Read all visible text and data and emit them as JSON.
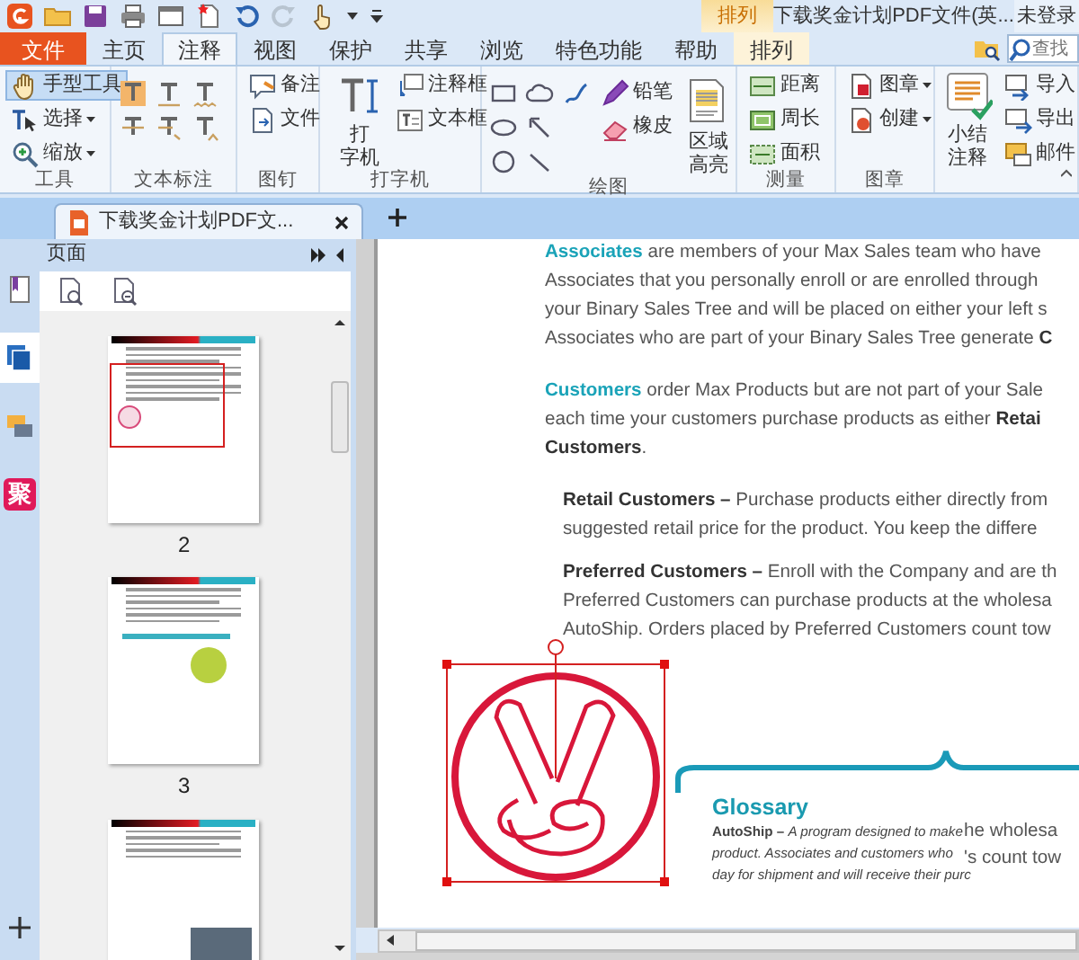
{
  "quick_access": {
    "redo_disabled": true
  },
  "window": {
    "context_tab": "排列",
    "title": "下载奖金计划PDF文件(英...",
    "account": "未登录"
  },
  "tabs": [
    {
      "label": "文件",
      "kind": "file",
      "selected": false
    },
    {
      "label": "主页",
      "kind": "tab",
      "selected": false
    },
    {
      "label": "注释",
      "kind": "tab",
      "selected": true
    },
    {
      "label": "视图",
      "kind": "tab",
      "selected": false
    },
    {
      "label": "保护",
      "kind": "tab",
      "selected": false
    },
    {
      "label": "共享",
      "kind": "tab",
      "selected": false
    },
    {
      "label": "浏览",
      "kind": "tab",
      "selected": false
    },
    {
      "label": "特色功能",
      "kind": "tab",
      "selected": false
    },
    {
      "label": "帮助",
      "kind": "tab",
      "selected": false
    },
    {
      "label": "排列",
      "kind": "context",
      "selected": false
    }
  ],
  "search": {
    "placeholder": "查找"
  },
  "ribbon": [
    {
      "label": "工具",
      "columns": [
        [
          {
            "kind": "small",
            "label": "手型工具",
            "selected": true
          },
          {
            "kind": "small",
            "label": "选择",
            "dropdown": true,
            "selected": false
          },
          {
            "kind": "small",
            "label": "缩放",
            "dropdown": true,
            "selected": false
          }
        ]
      ]
    },
    {
      "label": "文本标注",
      "columns": [
        [
          {
            "kind": "icon"
          },
          {
            "kind": "icon"
          }
        ],
        [
          {
            "kind": "icon"
          },
          {
            "kind": "icon"
          }
        ],
        [
          {
            "kind": "icon"
          },
          {
            "kind": "icon"
          }
        ]
      ]
    },
    {
      "label": "图钉",
      "columns": [
        [
          {
            "kind": "small",
            "label": "备注"
          },
          {
            "kind": "small",
            "label": "文件"
          }
        ]
      ]
    },
    {
      "label": "打字机",
      "columns": [
        [
          {
            "kind": "large",
            "lines": [
              "打",
              "字机"
            ]
          }
        ],
        [
          {
            "kind": "small",
            "label": "注释框"
          },
          {
            "kind": "small",
            "label": "文本框"
          }
        ]
      ]
    },
    {
      "label": "绘图",
      "columns": [
        [
          {
            "kind": "icon"
          },
          {
            "kind": "icon"
          },
          {
            "kind": "icon"
          }
        ],
        [
          {
            "kind": "icon"
          },
          {
            "kind": "icon"
          },
          {
            "kind": "icon"
          }
        ],
        [
          {
            "kind": "icon"
          }
        ],
        [
          {
            "kind": "small",
            "label": "铅笔"
          },
          {
            "kind": "small",
            "label": "橡皮"
          }
        ],
        [
          {
            "kind": "large",
            "lines": [
              "区域",
              "高亮"
            ]
          }
        ]
      ]
    },
    {
      "label": "测量",
      "columns": [
        [
          {
            "kind": "small",
            "label": "距离"
          },
          {
            "kind": "small",
            "label": "周长"
          },
          {
            "kind": "small",
            "label": "面积"
          }
        ]
      ]
    },
    {
      "label": "图章",
      "columns": [
        [
          {
            "kind": "small",
            "label": "图章",
            "dropdown": true
          },
          {
            "kind": "small",
            "label": "创建",
            "dropdown": true
          }
        ]
      ]
    },
    {
      "columns": [
        [
          {
            "kind": "large",
            "lines": [
              "小结",
              "注释"
            ]
          }
        ],
        [
          {
            "kind": "small",
            "label": "导入"
          },
          {
            "kind": "small",
            "label": "导出"
          },
          {
            "kind": "small",
            "label": "邮件"
          }
        ]
      ]
    }
  ],
  "doc_tabs": [
    {
      "label": "下载奖金计划PDF文...",
      "selected": true
    }
  ],
  "sidebar_tabs": [
    {
      "kind": "icon",
      "selected": false
    },
    {
      "kind": "icon",
      "selected": true
    },
    {
      "kind": "icon",
      "selected": false
    },
    {
      "kind": "badge",
      "label": "聚",
      "selected": false
    }
  ],
  "pages_panel": {
    "title": "页面",
    "thumbnails": [
      {
        "kind": "stamp-page",
        "label": "2",
        "current": true
      },
      {
        "kind": "chart-page",
        "label": "3",
        "current": false
      },
      {
        "kind": "photo-page",
        "current": false
      }
    ]
  },
  "document": {
    "paragraphs": [
      {
        "term": "Associates",
        "indent": false,
        "lines": [
          " are members of your Max Sales team who have",
          "Associates that you personally enroll or are enrolled through",
          "your Binary Sales Tree and will be placed on either your left s",
          "Associates who are part of your Binary Sales Tree generate **C**"
        ]
      },
      {
        "term": "Customers",
        "indent": false,
        "lines": [
          " order Max Products but are not part of your Sale",
          "each time your customers purchase products as either **Retai**",
          "**Customers**."
        ]
      },
      {
        "indent": true,
        "lines": [
          "**Retail Customers –** Purchase products either directly from",
          "suggested retail price for the product. You keep the differe"
        ]
      },
      {
        "indent": true,
        "lines": [
          "**Preferred Customers –** Enroll with the Company and are th",
          "Preferred Customers can purchase products at the wholesa",
          "AutoShip. Orders placed by Preferred Customers count tow"
        ]
      }
    ],
    "stamp": {
      "selected": true
    },
    "glossary": {
      "title": "Glossary",
      "lines": [
        "**AutoShip –** *A program designed to make*",
        "*product. Associates and customers who*",
        "*day for shipment and will receive their purc*"
      ],
      "overlay_lines": [
        "he wholesa",
        "'s count tow"
      ]
    }
  }
}
